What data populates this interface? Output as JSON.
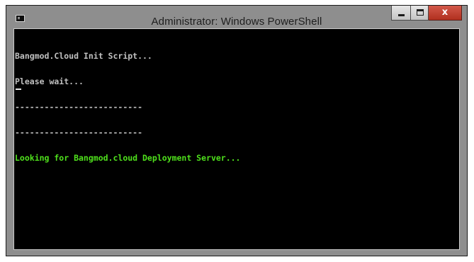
{
  "window": {
    "title": "Administrator: Windows PowerShell"
  },
  "controls": {
    "close_glyph": "x"
  },
  "console": {
    "lines": [
      "Bangmod.Cloud Init Script...",
      "Please wait...",
      "--------------------------",
      "--------------------------",
      "Looking for Bangmod.cloud Deployment Server..."
    ],
    "colors": {
      "background": "#000000",
      "default_text": "#c0c0c0",
      "highlight_text": "#4fe11c"
    }
  },
  "icons": {
    "app_icon": "console-icon",
    "minimize": "minimize-icon",
    "maximize": "maximize-icon",
    "close": "close-icon"
  }
}
